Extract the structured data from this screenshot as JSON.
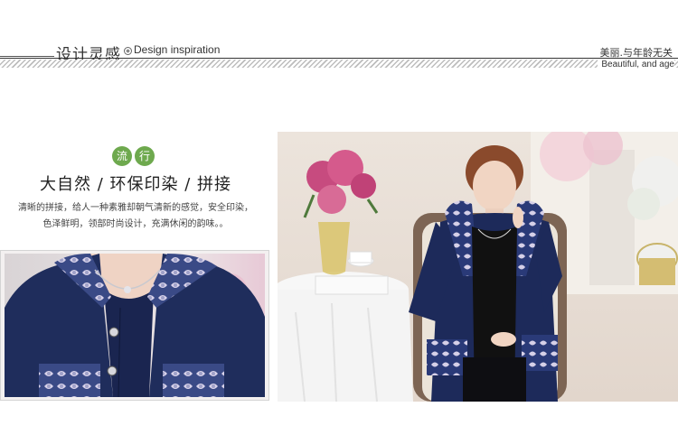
{
  "header": {
    "title_zh": "设计灵感",
    "title_en": "Design inspiration",
    "right_zh": "美丽.与年龄无关",
    "right_en": "Beautiful, and age"
  },
  "badges": [
    "流",
    "行"
  ],
  "headline": "大自然 / 环保印染 / 拼接",
  "description": {
    "line1": "清晰的拼接，给人一种素雅却朝气清新的感觉，安全印染，",
    "line2": "色泽鲜明，领部时尚设计，充满休闲的韵味。。"
  },
  "images": {
    "detail": "jacket-detail-photo",
    "model": "model-seated-photo"
  },
  "colors": {
    "accent_green": "#6ea94e",
    "denim_navy": "#1d2a55",
    "floral": "#c9c2dc"
  }
}
